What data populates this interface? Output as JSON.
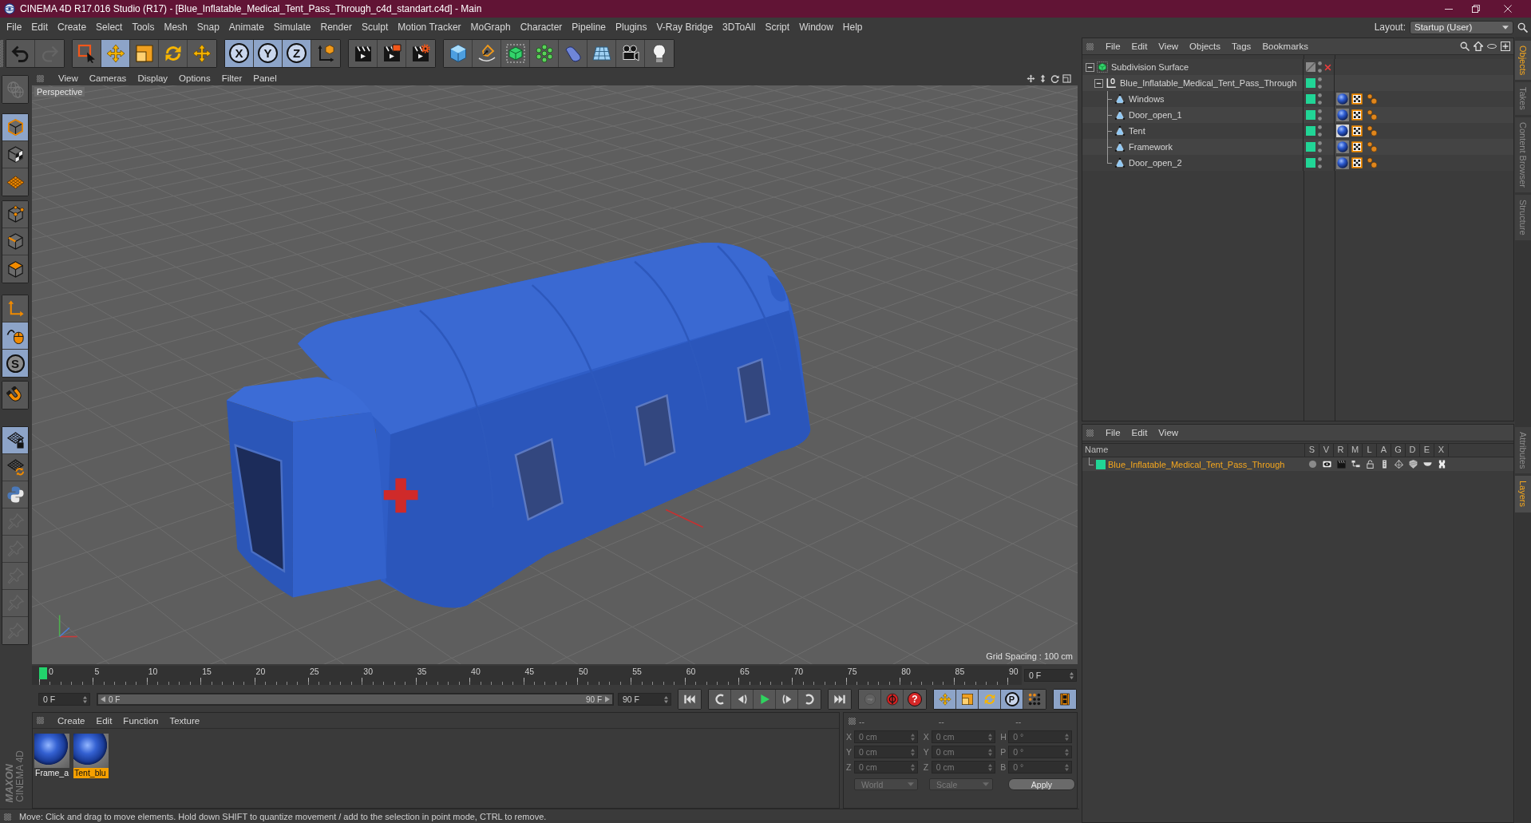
{
  "window": {
    "title": "CINEMA 4D R17.016 Studio (R17) - [Blue_Inflatable_Medical_Tent_Pass_Through_c4d_standart.c4d] - Main"
  },
  "menu_bar": [
    "File",
    "Edit",
    "Create",
    "Select",
    "Tools",
    "Mesh",
    "Snap",
    "Animate",
    "Simulate",
    "Render",
    "Sculpt",
    "Motion Tracker",
    "MoGraph",
    "Character",
    "Pipeline",
    "Plugins",
    "V-Ray Bridge",
    "3DToAll",
    "Script",
    "Window",
    "Help"
  ],
  "layout": {
    "label": "Layout:",
    "value": "Startup (User)"
  },
  "toolbar": [
    [
      {
        "kind": "undo",
        "selected": false,
        "disabled": false
      },
      {
        "kind": "redo",
        "selected": false,
        "disabled": true
      }
    ],
    [
      {
        "kind": "live_selection",
        "selected": false,
        "disabled": false
      },
      {
        "kind": "move",
        "selected": true,
        "disabled": false
      },
      {
        "kind": "scale",
        "selected": false,
        "disabled": false
      },
      {
        "kind": "rotate",
        "selected": false,
        "disabled": false
      },
      {
        "kind": "recent_tool",
        "selected": false,
        "disabled": false
      }
    ],
    [
      {
        "kind": "axis_lock",
        "label": "X",
        "selected": true,
        "disabled": false
      },
      {
        "kind": "axis_lock",
        "label": "Y",
        "selected": true,
        "disabled": false
      },
      {
        "kind": "axis_lock",
        "label": "Z",
        "selected": true,
        "disabled": false
      },
      {
        "kind": "coordinate_system",
        "selected": false,
        "disabled": false
      }
    ],
    [
      {
        "kind": "render_view",
        "selected": false,
        "disabled": false
      },
      {
        "kind": "render_picture_viewer",
        "selected": false,
        "disabled": false
      },
      {
        "kind": "render_settings",
        "selected": false,
        "disabled": false
      }
    ],
    [
      {
        "kind": "cube",
        "selected": false,
        "disabled": false
      },
      {
        "kind": "pen",
        "selected": false,
        "disabled": false
      },
      {
        "kind": "subdivision",
        "selected": false,
        "disabled": false
      },
      {
        "kind": "cloner",
        "selected": false,
        "disabled": false
      },
      {
        "kind": "bend",
        "selected": false,
        "disabled": false
      },
      {
        "kind": "floor",
        "selected": false,
        "disabled": false
      },
      {
        "kind": "camera",
        "selected": false,
        "disabled": false
      },
      {
        "kind": "light",
        "selected": false,
        "disabled": false
      }
    ]
  ],
  "mode_toolbar": [
    [
      {
        "kind": "globe",
        "selected": false,
        "disabled": true
      }
    ],
    [
      {
        "kind": "model",
        "selected": true,
        "disabled": false
      },
      {
        "kind": "texture",
        "selected": false,
        "disabled": false
      },
      {
        "kind": "workplane",
        "selected": false,
        "disabled": false
      }
    ],
    [
      {
        "kind": "points",
        "selected": false,
        "disabled": false
      },
      {
        "kind": "edges",
        "selected": false,
        "disabled": false
      },
      {
        "kind": "polygons",
        "selected": false,
        "disabled": false
      }
    ],
    [
      {
        "kind": "axis_mode",
        "selected": false,
        "disabled": false
      },
      {
        "kind": "tweak",
        "selected": true,
        "disabled": false
      },
      {
        "kind": "soft_selection",
        "label": "S",
        "selected": true,
        "disabled": false
      }
    ],
    [
      {
        "kind": "magnet",
        "selected": false,
        "disabled": false
      }
    ],
    [
      {
        "kind": "snap_lock",
        "selected": true,
        "disabled": false
      },
      {
        "kind": "snap_sync",
        "selected": false,
        "disabled": false
      },
      {
        "kind": "python",
        "selected": false,
        "disabled": false
      },
      {
        "kind": "pin",
        "selected": false,
        "disabled": true
      },
      {
        "kind": "pin",
        "selected": false,
        "disabled": true
      },
      {
        "kind": "pin",
        "selected": false,
        "disabled": true
      },
      {
        "kind": "pin",
        "selected": false,
        "disabled": true
      },
      {
        "kind": "pin",
        "selected": false,
        "disabled": true
      }
    ]
  ],
  "viewport": {
    "menu": [
      "View",
      "Cameras",
      "Display",
      "Options",
      "Filter",
      "Panel"
    ],
    "camera": "Perspective",
    "grid_spacing": "Grid Spacing : 100 cm"
  },
  "object_manager": {
    "menu": [
      "File",
      "Edit",
      "View",
      "Objects",
      "Tags",
      "Bookmarks"
    ],
    "objects": [
      {
        "name": "Subdivision Surface",
        "kind": "subdivision",
        "selected": false,
        "expanded": true,
        "enabled": false,
        "children": [
          {
            "name": "Blue_Inflatable_Medical_Tent_Pass_Through",
            "kind": "null",
            "selected": false,
            "expanded": true,
            "color": "#21d596",
            "children": [
              {
                "name": "Windows",
                "kind": "polygon",
                "selected": false,
                "color": "#21d596",
                "tags": [
                  {
                    "kind": "material",
                    "selected": false
                  },
                  {
                    "kind": "uvw"
                  },
                  {
                    "kind": "phong"
                  }
                ]
              },
              {
                "name": "Door_open_1",
                "kind": "polygon",
                "selected": false,
                "color": "#21d596",
                "tags": [
                  {
                    "kind": "material",
                    "selected": false
                  },
                  {
                    "kind": "uvw"
                  },
                  {
                    "kind": "phong"
                  }
                ]
              },
              {
                "name": "Tent",
                "kind": "polygon",
                "selected": false,
                "color": "#21d596",
                "tags": [
                  {
                    "kind": "material",
                    "selected": true
                  },
                  {
                    "kind": "uvw"
                  },
                  {
                    "kind": "phong"
                  }
                ]
              },
              {
                "name": "Framework",
                "kind": "polygon",
                "selected": false,
                "color": "#21d596",
                "tags": [
                  {
                    "kind": "material",
                    "selected": false
                  },
                  {
                    "kind": "uvw"
                  },
                  {
                    "kind": "phong"
                  }
                ]
              },
              {
                "name": "Door_open_2",
                "kind": "polygon",
                "selected": false,
                "color": "#21d596",
                "tags": [
                  {
                    "kind": "material",
                    "selected": false
                  },
                  {
                    "kind": "uvw"
                  },
                  {
                    "kind": "phong"
                  }
                ]
              }
            ]
          }
        ]
      }
    ]
  },
  "side_tabs": {
    "upper": [
      {
        "label": "Objects",
        "selected": true
      },
      {
        "label": "Takes",
        "selected": false
      },
      {
        "label": "Content Browser",
        "selected": false
      },
      {
        "label": "Structure",
        "selected": false
      }
    ],
    "lower": [
      {
        "label": "Attributes",
        "selected": false
      },
      {
        "label": "Layers",
        "selected": true
      }
    ]
  },
  "layer_manager": {
    "menu": [
      "File",
      "Edit",
      "View"
    ],
    "columns": [
      "Name",
      "S",
      "V",
      "R",
      "M",
      "L",
      "A",
      "G",
      "D",
      "E",
      "X"
    ],
    "layers": [
      {
        "name": "Blue_Inflatable_Medical_Tent_Pass_Through",
        "color": "#21d596",
        "selected": true
      }
    ]
  },
  "timeline": {
    "ticks": [
      "0",
      "5",
      "10",
      "15",
      "20",
      "25",
      "30",
      "35",
      "40",
      "45",
      "50",
      "55",
      "60",
      "65",
      "70",
      "75",
      "80",
      "85",
      "90"
    ],
    "playhead": {
      "level": 0
    },
    "current_frame": "0 F",
    "start_frame": "0 F",
    "range": {
      "start": "0 F",
      "end": "90 F",
      "level": 1
    },
    "end_frame": "90 F",
    "transport": [
      [
        {
          "kind": "go_start",
          "selected": false,
          "disabled": false
        }
      ],
      [
        {
          "kind": "prev_key",
          "selected": false,
          "disabled": false
        },
        {
          "kind": "prev_frame",
          "selected": false,
          "disabled": false
        },
        {
          "kind": "play",
          "selected": false,
          "disabled": false
        },
        {
          "kind": "next_frame",
          "selected": false,
          "disabled": false
        },
        {
          "kind": "next_key",
          "selected": false,
          "disabled": false
        }
      ],
      [
        {
          "kind": "go_end",
          "selected": false,
          "disabled": false
        }
      ],
      [
        {
          "kind": "record",
          "selected": false,
          "disabled": true
        },
        {
          "kind": "autokey",
          "selected": false,
          "disabled": false
        },
        {
          "kind": "keyframe_selection",
          "label": "?",
          "selected": false,
          "disabled": false
        }
      ],
      [
        {
          "kind": "key_position",
          "selected": true,
          "disabled": false
        },
        {
          "kind": "key_scale",
          "selected": true,
          "disabled": false
        },
        {
          "kind": "key_rotation",
          "selected": true,
          "disabled": false
        },
        {
          "kind": "key_parameter",
          "label": "P",
          "selected": true,
          "disabled": false
        },
        {
          "kind": "key_pla",
          "selected": false,
          "disabled": false
        }
      ],
      [
        {
          "kind": "timeline_window",
          "selected": true,
          "disabled": false
        }
      ]
    ]
  },
  "materials": {
    "menu": [
      "Create",
      "Edit",
      "Function",
      "Texture"
    ],
    "items": [
      {
        "name": "Frame_a",
        "selected": false
      },
      {
        "name": "Tent_blu",
        "selected": true
      }
    ]
  },
  "coordinates": {
    "disabled": true,
    "columns": [
      {
        "header": "--",
        "fields": [
          {
            "label": "X",
            "value": "0 cm"
          },
          {
            "label": "Y",
            "value": "0 cm"
          },
          {
            "label": "Z",
            "value": "0 cm"
          }
        ]
      },
      {
        "header": "--",
        "fields": [
          {
            "label": "X",
            "value": "0 cm"
          },
          {
            "label": "Y",
            "value": "0 cm"
          },
          {
            "label": "Z",
            "value": "0 cm"
          }
        ]
      },
      {
        "header": "--",
        "fields": [
          {
            "label": "H",
            "value": "0 °"
          },
          {
            "label": "P",
            "value": "0 °"
          },
          {
            "label": "B",
            "value": "0 °"
          }
        ]
      }
    ],
    "dropdowns": [
      "World",
      "Scale"
    ],
    "apply": "Apply"
  },
  "logo": {
    "brand": "MAXON",
    "product": "CINEMA 4D"
  },
  "status_bar": "Move: Click and drag to move elements. Hold down SHIFT to quantize movement / add to the selection in point mode, CTRL to remove."
}
